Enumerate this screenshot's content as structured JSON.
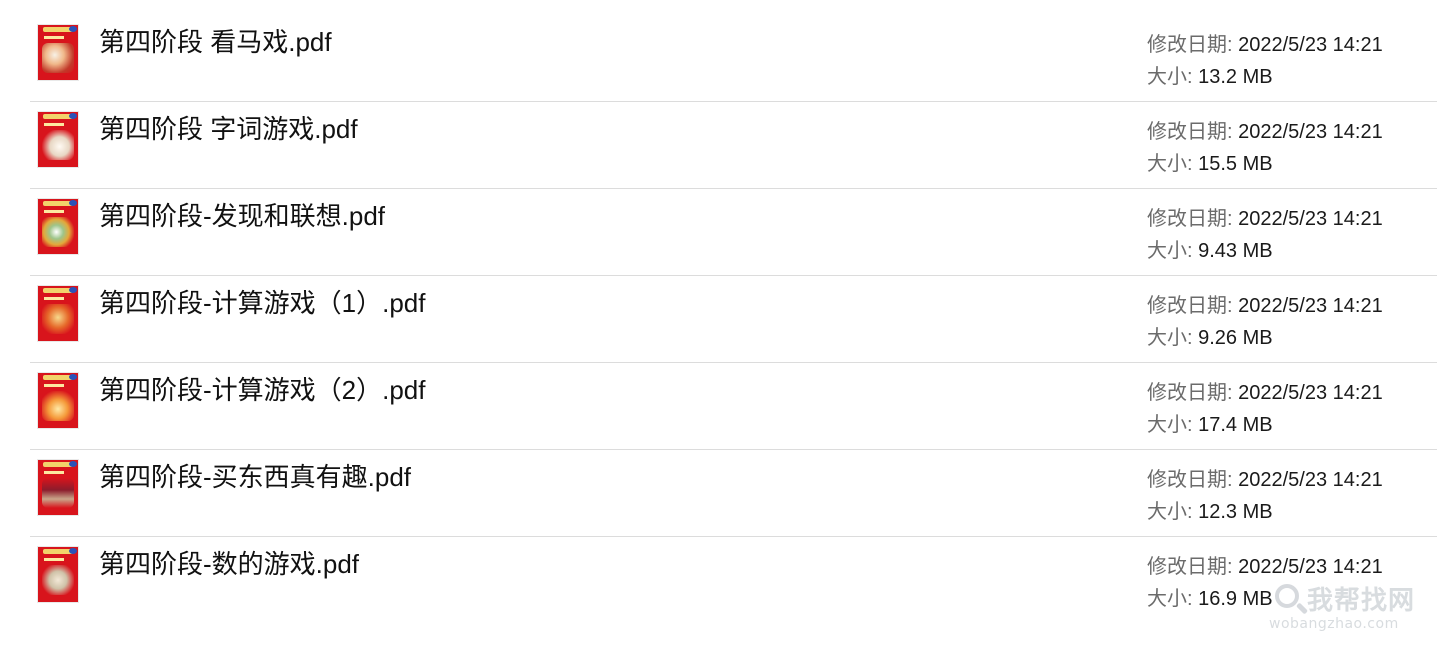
{
  "labels": {
    "modified_label": "修改日期:",
    "size_label": "大小:"
  },
  "files": [
    {
      "name": "第四阶段 看马戏.pdf",
      "modified": "2022/5/23 14:21",
      "size": "13.2 MB"
    },
    {
      "name": "第四阶段 字词游戏.pdf",
      "modified": "2022/5/23 14:21",
      "size": "15.5 MB"
    },
    {
      "name": "第四阶段-发现和联想.pdf",
      "modified": "2022/5/23 14:21",
      "size": "9.43 MB"
    },
    {
      "name": "第四阶段-计算游戏（1）.pdf",
      "modified": "2022/5/23 14:21",
      "size": "9.26 MB"
    },
    {
      "name": "第四阶段-计算游戏（2）.pdf",
      "modified": "2022/5/23 14:21",
      "size": "17.4 MB"
    },
    {
      "name": "第四阶段-买东西真有趣.pdf",
      "modified": "2022/5/23 14:21",
      "size": "12.3 MB"
    },
    {
      "name": "第四阶段-数的游戏.pdf",
      "modified": "2022/5/23 14:21",
      "size": "16.9 MB"
    }
  ],
  "watermark": {
    "cn": "我帮找网",
    "en": "wobangzhao.com"
  },
  "colors": {
    "label_gray": "#6b6b6b",
    "thumbnail_red": "#d8141c",
    "divider": "#dcdcdc"
  },
  "icons": {
    "file_thumbnail": "pdf-thumbnail-icon",
    "watermark_logo": "magnifier-icon"
  }
}
